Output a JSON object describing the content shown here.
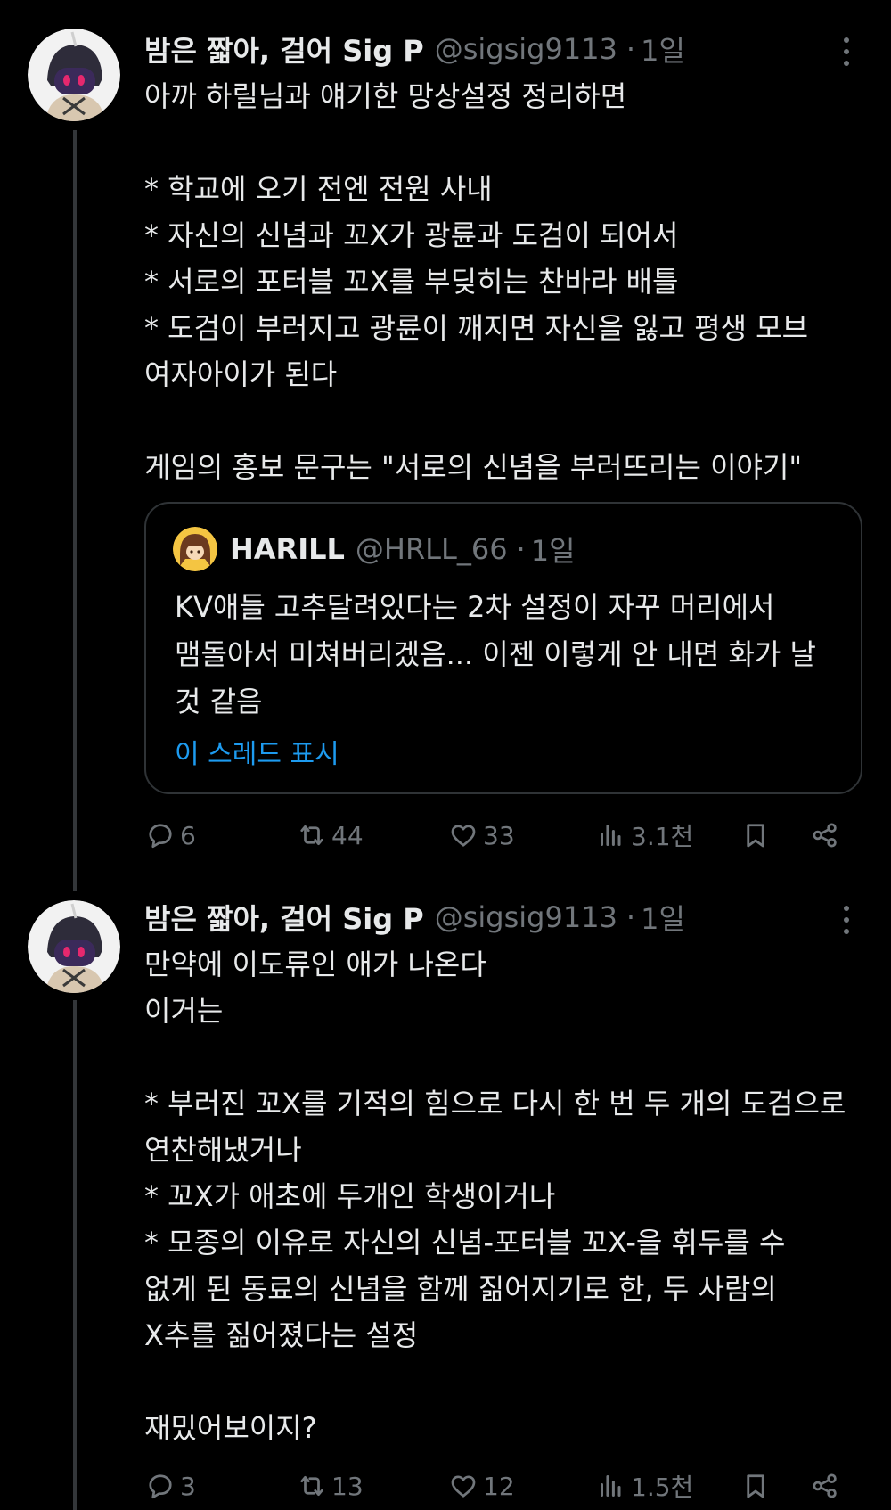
{
  "colors": {
    "background": "#000000",
    "text": "#e7e9ea",
    "muted": "#71767b",
    "link": "#1d9bf0",
    "border": "#2f3336"
  },
  "tweets": [
    {
      "display_name": "밤은 짧아, 걸어 Sig P",
      "handle": "@sigsig9113",
      "separator": "·",
      "time": "1일",
      "avatar_icon": "avatar-hooded-character",
      "more_icon": "more-vertical-icon",
      "lines": [
        "아까 하릴님과 얘기한 망상설정 정리하면",
        "",
        "* 학교에 오기 전엔 전원 사내",
        "* 자신의 신념과 꼬X가 광륜과 도검이 되어서",
        "* 서로의 포터블 꼬X를 부딪히는 찬바라 배틀",
        "* 도검이 부러지고 광륜이 깨지면 자신을 잃고 평생 모브",
        "여자아이가 된다",
        "",
        "게임의 홍보 문구는 \"서로의 신념을 부러뜨리는 이야기\""
      ],
      "quote": {
        "display_name": "HARILL",
        "handle": "@HRLL_66",
        "separator": "·",
        "time": "1일",
        "avatar_icon": "avatar-brown-hair-character",
        "lines": [
          "KV애들 고추달려있다는 2차 설정이 자꾸 머리에서",
          "맴돌아서 미쳐버리겠음... 이젠 이렇게 안 내면 화가 날",
          "것 같음"
        ],
        "show_thread": "이 스레드 표시"
      },
      "actions": {
        "replies": "6",
        "retweets": "44",
        "likes": "33",
        "views": "3.1천"
      }
    },
    {
      "display_name": "밤은 짧아, 걸어 Sig P",
      "handle": "@sigsig9113",
      "separator": "·",
      "time": "1일",
      "avatar_icon": "avatar-hooded-character",
      "more_icon": "more-vertical-icon",
      "lines": [
        "만약에 이도류인 애가 나온다",
        "이거는",
        "",
        "* 부러진 꼬X를 기적의 힘으로 다시 한 번 두 개의 도검으로",
        "연찬해냈거나",
        "* 꼬X가 애초에 두개인 학생이거나",
        "* 모종의 이유로 자신의 신념-포터블 꼬X-을 휘두를 수",
        "없게 된 동료의 신념을 함께 짊어지기로 한, 두 사람의",
        "X추를 짊어졌다는 설정",
        "",
        "재밌어보이지?"
      ],
      "actions": {
        "replies": "3",
        "retweets": "13",
        "likes": "12",
        "views": "1.5천"
      }
    }
  ]
}
